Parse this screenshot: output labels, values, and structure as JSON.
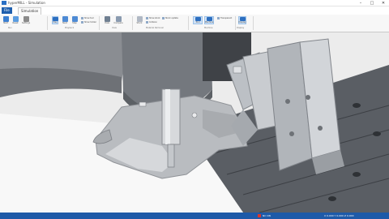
{
  "window": {
    "title": "hyperMILL - Simulation",
    "controls": [
      "–",
      "□",
      "✕"
    ]
  },
  "ribbon": {
    "tabs": [
      {
        "label": "File",
        "kind": "file"
      },
      {
        "label": "Simulation",
        "kind": "active"
      }
    ],
    "groups": [
      {
        "label": "Run"
      },
      {
        "label": "Playback"
      },
      {
        "label": "View"
      },
      {
        "label": "Material Removal"
      },
      {
        "label": "Machine"
      },
      {
        "label": "Display"
      }
    ],
    "buttons": [
      {
        "icon": "start-icon",
        "label": "Start"
      },
      {
        "icon": "reset-icon",
        "label": "Reset"
      },
      {
        "icon": "settings-icon",
        "label": "Settings"
      },
      {
        "icon": "play-icon",
        "label": "Play"
      },
      {
        "icon": "fast-forward-icon",
        "label": "Next"
      },
      {
        "icon": "step-icon",
        "label": "Step"
      },
      {
        "icon": "view-icon",
        "label": "View"
      },
      {
        "icon": "compare-icon",
        "label": "Compare"
      },
      {
        "icon": "stock-icon",
        "label": "Stock"
      },
      {
        "icon": "tool-icon",
        "label": "Tool"
      },
      {
        "icon": "machine-icon",
        "label": "Machine"
      },
      {
        "icon": "display-icon",
        "label": "Display"
      }
    ],
    "small_items": [
      {
        "label": "Show tool"
      },
      {
        "label": "Show holder"
      },
      {
        "label": "Show stock"
      },
      {
        "label": "Collision"
      },
      {
        "label": "Stock update"
      },
      {
        "label": "Transparent"
      }
    ]
  },
  "status": {
    "indicator_text": "NC ON",
    "coordinates": "X 0.000  Y 0.000  Z 0.000"
  },
  "colors": {
    "accent": "#1e5aa8",
    "ribbon_bg": "#f7f7f7",
    "viewport_bg": "#ececec"
  }
}
